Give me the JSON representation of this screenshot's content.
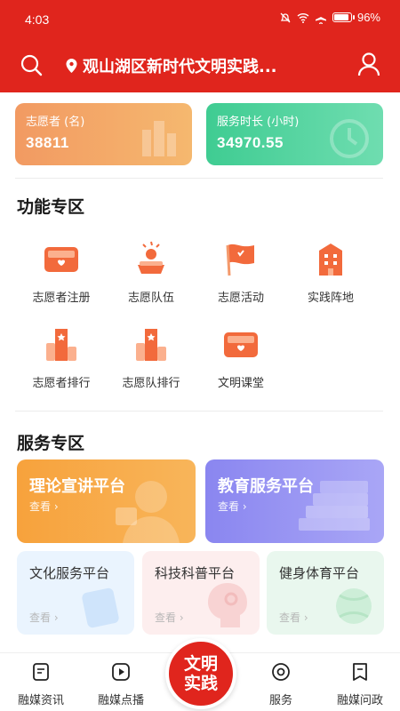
{
  "status_bar": {
    "time": "4:03",
    "battery": "96%"
  },
  "header": {
    "location": "观山湖区新时代文明实践..."
  },
  "stats": [
    {
      "label": "志愿者 (名)",
      "value": "38811"
    },
    {
      "label": "服务时长 (小时)",
      "value": "34970.55"
    }
  ],
  "functions": {
    "title": "功能专区",
    "items": [
      {
        "label": "志愿者注册",
        "icon": "register-icon"
      },
      {
        "label": "志愿队伍",
        "icon": "team-icon"
      },
      {
        "label": "志愿活动",
        "icon": "activity-flag-icon"
      },
      {
        "label": "实践阵地",
        "icon": "building-icon"
      },
      {
        "label": "志愿者排行",
        "icon": "rank-icon"
      },
      {
        "label": "志愿队排行",
        "icon": "team-rank-icon"
      },
      {
        "label": "文明课堂",
        "icon": "classroom-icon"
      }
    ]
  },
  "services": {
    "title": "服务专区",
    "cards": [
      {
        "title": "理论宣讲平台",
        "more": "查看 ›"
      },
      {
        "title": "教育服务平台",
        "more": "查看 ›"
      },
      {
        "title": "文化服务平台",
        "more": "查看 ›"
      },
      {
        "title": "科技科普平台",
        "more": "查看 ›"
      },
      {
        "title": "健身体育平台",
        "more": "查看 ›"
      }
    ]
  },
  "bottom_nav": {
    "items": [
      {
        "label": "融媒资讯"
      },
      {
        "label": "融媒点播"
      },
      {
        "label": "服务"
      },
      {
        "label": "融媒问政"
      }
    ],
    "center": "文明实践"
  },
  "colors": {
    "brand_red": "#e0251d",
    "orange": "#f7a23c",
    "green": "#3fcc92",
    "purple": "#8a86f0"
  }
}
